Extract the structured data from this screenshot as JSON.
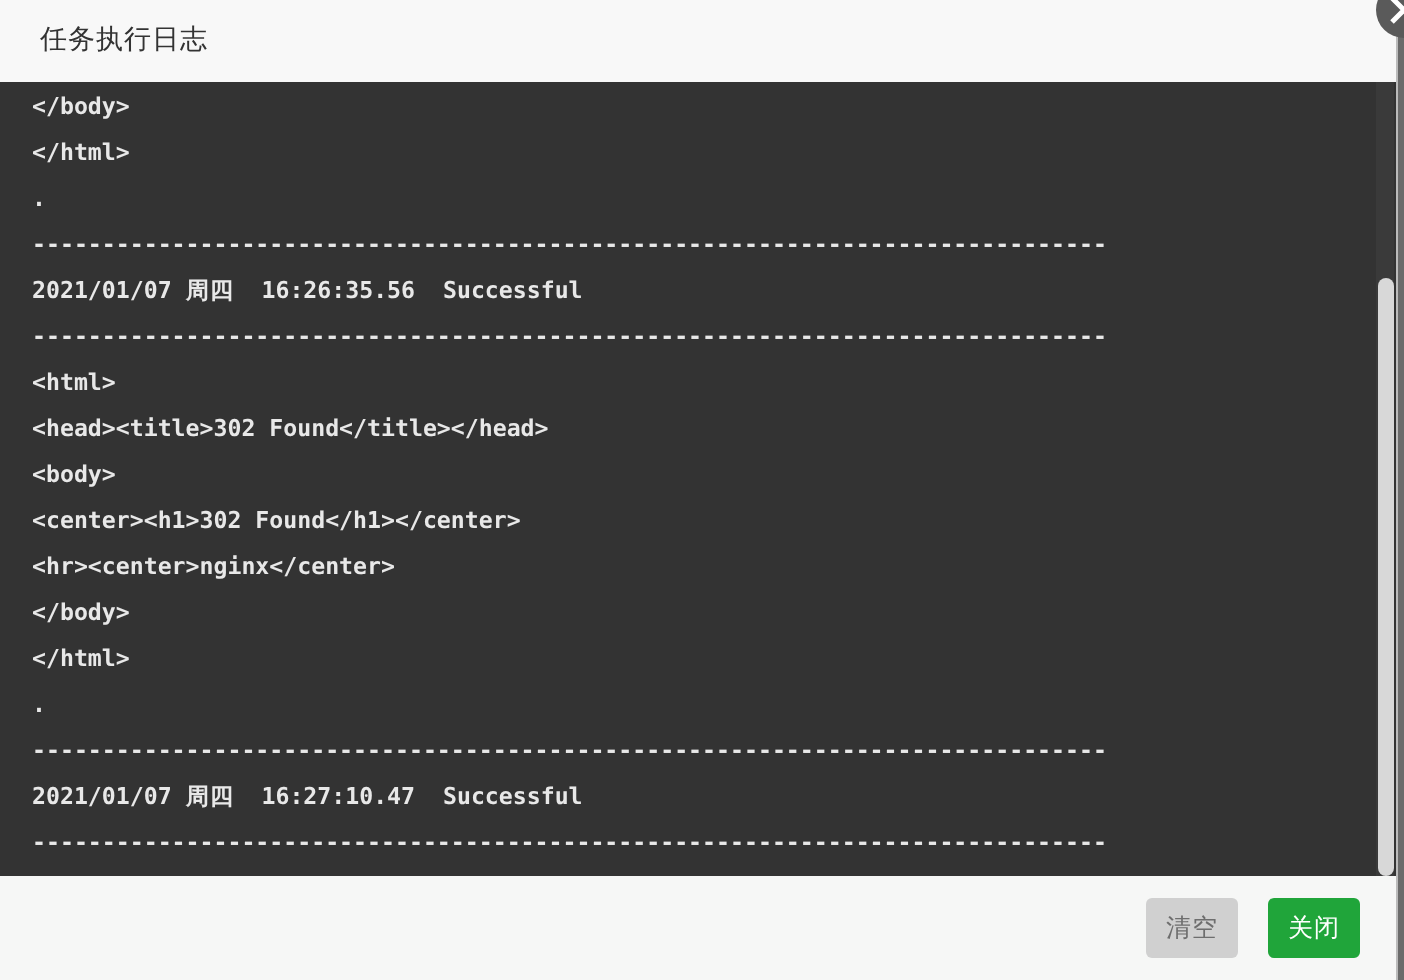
{
  "dialog": {
    "title": "任务执行日志"
  },
  "log_lines": [
    "</body>",
    "</html>",
    ".",
    "-----------------------------------------------------------------------------",
    "2021/01/07 周四  16:26:35.56  Successful",
    "-----------------------------------------------------------------------------",
    "<html>",
    "<head><title>302 Found</title></head>",
    "<body>",
    "<center><h1>302 Found</h1></center>",
    "<hr><center>nginx</center>",
    "</body>",
    "</html>",
    ".",
    "-----------------------------------------------------------------------------",
    "2021/01/07 周四  16:27:10.47  Successful",
    "-----------------------------------------------------------------------------"
  ],
  "buttons": [
    {
      "label": "清空",
      "disabled": true
    },
    {
      "label": "关闭",
      "disabled": false
    }
  ]
}
